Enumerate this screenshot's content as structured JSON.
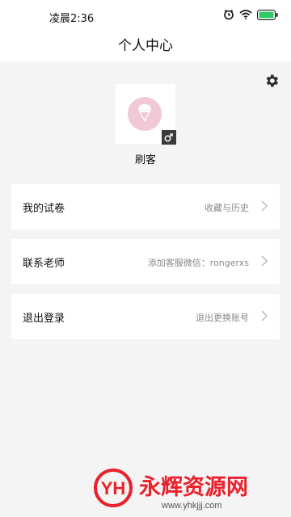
{
  "status": {
    "time": "凌晨2:36"
  },
  "header": {
    "title": "个人中心"
  },
  "settings": {
    "icon": "gear-icon"
  },
  "profile": {
    "name": "刷客",
    "avatar_color": "#f0c8d6",
    "gender_icon": "male-icon"
  },
  "menu": [
    {
      "label": "我的试卷",
      "detail": "收藏与历史"
    },
    {
      "label": "联系老师",
      "detail": "添加客服微信：rongerxs"
    },
    {
      "label": "退出登录",
      "detail": "退出更换账号"
    }
  ],
  "watermark": {
    "mark": "YH",
    "brand": "永辉资源网",
    "url": "www.yhkjjj.com",
    "brand_color": "#e8212d"
  }
}
